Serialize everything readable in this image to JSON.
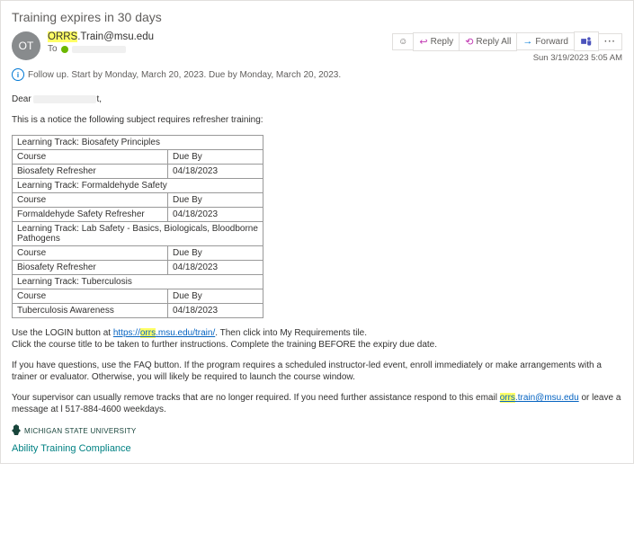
{
  "subject": "Training expires in 30 days",
  "from": {
    "prefix_hl": "ORRS",
    "rest": ".Train@msu.edu",
    "initials": "OT"
  },
  "to_label": "To",
  "timestamp": "Sun 3/19/2023 5:05 AM",
  "followup_text": "Follow up.  Start by Monday, March 20, 2023.  Due by Monday, March 20, 2023.",
  "actions": {
    "reply": "Reply",
    "reply_all": "Reply All",
    "forward": "Forward"
  },
  "greeting_prefix": "Dear ",
  "greeting_suffix": "t,",
  "intro": "This is a notice the following subject requires refresher training:",
  "tracks": [
    {
      "track": "Learning Track: Biosafety Principles",
      "course_header": "Course",
      "due_header": "Due By",
      "course": "Biosafety Refresher",
      "due": "04/18/2023"
    },
    {
      "track": "Learning Track: Formaldehyde Safety",
      "course_header": "Course",
      "due_header": "Due By",
      "course": "Formaldehyde Safety Refresher",
      "due": "04/18/2023"
    },
    {
      "track": "Learning Track: Lab Safety - Basics, Biologicals, Bloodborne Pathogens",
      "course_header": "Course",
      "due_header": "Due By",
      "course": "Biosafety Refresher",
      "due": "04/18/2023"
    },
    {
      "track": "Learning Track: Tuberculosis",
      "course_header": "Course",
      "due_header": "Due By",
      "course": "Tuberculosis Awareness",
      "due": "04/18/2023"
    }
  ],
  "instructions1_pre": "Use the LOGIN button at  ",
  "instructions1_link_pre": "https://",
  "instructions1_link_hl": "orrs",
  "instructions1_link_post": ".msu.edu/train/",
  "instructions1_post": ". Then click into My Requirements tile.",
  "instructions2": "Click the course title to be taken to further instructions. Complete the training BEFORE the expiry due date.",
  "instructions3": "If you have questions, use the FAQ button. If the program requires a scheduled instructor-led event, enroll immediately or make arrangements with a trainer or evaluator. Otherwise, you will likely be required to launch the course window.",
  "instructions4_pre": "Your supervisor can usually remove tracks that are no longer required. If you need further assistance respond to this email ",
  "instructions4_link_hl": "orrs",
  "instructions4_link_post": ".train@msu.edu",
  "instructions4_post": " or leave a message at l 517-884-4600 weekdays.",
  "footer_logo_text": "MICHIGAN STATE UNIVERSITY",
  "footer_compliance": "Ability Training Compliance"
}
